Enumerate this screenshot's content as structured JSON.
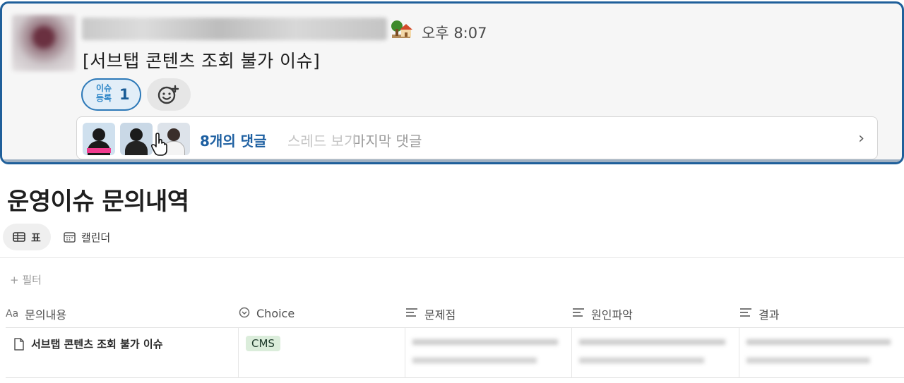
{
  "slack_message": {
    "time": "오후 8:07",
    "text": "[서브탭 콘텐츠 조회 불가 이슈]",
    "reaction": {
      "emoji_text": "이슈 등록",
      "count": "1"
    },
    "thread": {
      "reply_count": "8개의 댓글",
      "last_reply_label": "마지막 댓글",
      "last_reply_overlay": "스레드 보기"
    }
  },
  "database": {
    "title": "운영이슈 문의내역",
    "views": [
      {
        "label": "표",
        "icon": "table-icon",
        "active": true
      },
      {
        "label": "캘린더",
        "icon": "calendar-icon",
        "active": false
      }
    ],
    "filter_label": "필터",
    "columns": [
      {
        "label": "문의내용",
        "icon": "text-property-icon"
      },
      {
        "label": "Choice",
        "icon": "select-property-icon"
      },
      {
        "label": "문제점",
        "icon": "text-lines-icon"
      },
      {
        "label": "원인파악",
        "icon": "text-lines-icon"
      },
      {
        "label": "결과",
        "icon": "text-lines-icon"
      }
    ],
    "rows": [
      {
        "title": "서브탭 콘텐츠 조회 불가 이슈",
        "choice": "CMS"
      }
    ],
    "colors": {
      "cms_tag_bg": "#dbeddb",
      "cms_tag_text": "#1c3829"
    }
  }
}
